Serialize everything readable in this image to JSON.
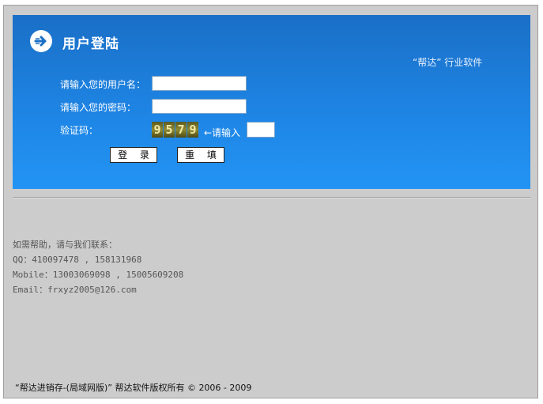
{
  "login": {
    "title": "用户登陆",
    "brand": "“帮达” 行业软件",
    "username_label": "请输入您的用户名：",
    "username_value": "",
    "password_label": "请输入您的密码：",
    "password_value": "",
    "captcha_label": "验证码：",
    "captcha_digits": [
      "9",
      "5",
      "7",
      "9"
    ],
    "captcha_hint": "←请输入",
    "captcha_value": "",
    "login_button": "登 录",
    "reset_button": "重 填",
    "icon": "arrow-right-icon"
  },
  "help": {
    "heading": "如需帮助，请与我们联系：",
    "qq": "QQ：410097478 , 158131968",
    "mobile": "Mobile：13003069098 , 15005609208",
    "email": "Email：frxyz2005@126.com"
  },
  "footer": {
    "text": "“帮达进销存-(局域网版)”   帮达软件版权所有 © 2006 - 2009"
  }
}
